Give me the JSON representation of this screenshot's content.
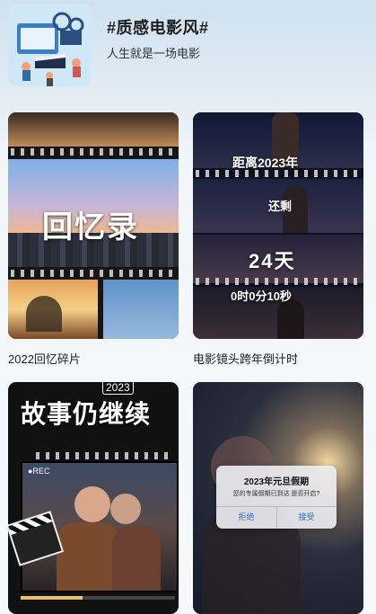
{
  "header": {
    "title": "#质感电影风#",
    "subtitle": "人生就是一场电影"
  },
  "templates": [
    {
      "label": "2022回忆碎片",
      "overlay_text": "回忆录"
    },
    {
      "label": "电影镜头跨年倒计时",
      "lines": [
        "距离2023年",
        "还剩",
        "24天",
        "0时0分10秒"
      ]
    },
    {
      "label": "",
      "headline": "故事仍继续",
      "year_badge": "2023",
      "rec_text": "●REC"
    },
    {
      "label": "",
      "dialog": {
        "title": "2023年元旦假期",
        "message": "您的专属假期已到达 是否开启?",
        "reject": "拒绝",
        "accept": "接受"
      }
    }
  ],
  "colors": {
    "dialog_button": "#2f6fd6",
    "background_top": "#cfe2ef",
    "background_bottom": "#f7f8fa"
  }
}
